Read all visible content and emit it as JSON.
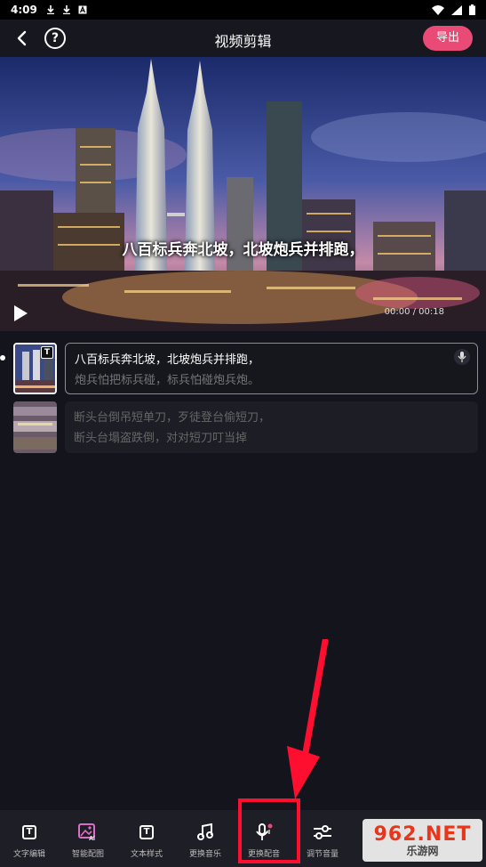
{
  "status": {
    "time": "4:09"
  },
  "header": {
    "title": "视频剪辑",
    "export_label": "导出",
    "help_glyph": "?"
  },
  "video": {
    "subtitle": "八百标兵奔北坡，北坡炮兵并排跑，",
    "time": "00:00 / 00:18"
  },
  "clips": [
    {
      "line1": "八百标兵奔北坡，北坡炮兵并排跑，",
      "line2": "炮兵怕把标兵碰，标兵怕碰炮兵炮。",
      "thumb_badge": "T"
    },
    {
      "line1": "断头台倒吊短单刀，歹徒登台偷短刀，",
      "line2": "断头台塌盗跌倒，对对短刀叮当掉"
    }
  ],
  "toolbar": {
    "items": [
      {
        "label": "文字编辑",
        "icon": "text-t-icon"
      },
      {
        "label": "智能配图",
        "icon": "ai-image-icon"
      },
      {
        "label": "文本样式",
        "icon": "text-style-icon"
      },
      {
        "label": "更换音乐",
        "icon": "music-note-icon"
      },
      {
        "label": "更换配音",
        "icon": "microphone-icon"
      },
      {
        "label": "调节音量",
        "icon": "sliders-icon"
      }
    ]
  },
  "watermark": {
    "line1": "962.NET",
    "line2": "乐游网"
  },
  "colors": {
    "accent": "#ea4a76",
    "annotation": "#ff0f2f",
    "background": "#14141c"
  }
}
